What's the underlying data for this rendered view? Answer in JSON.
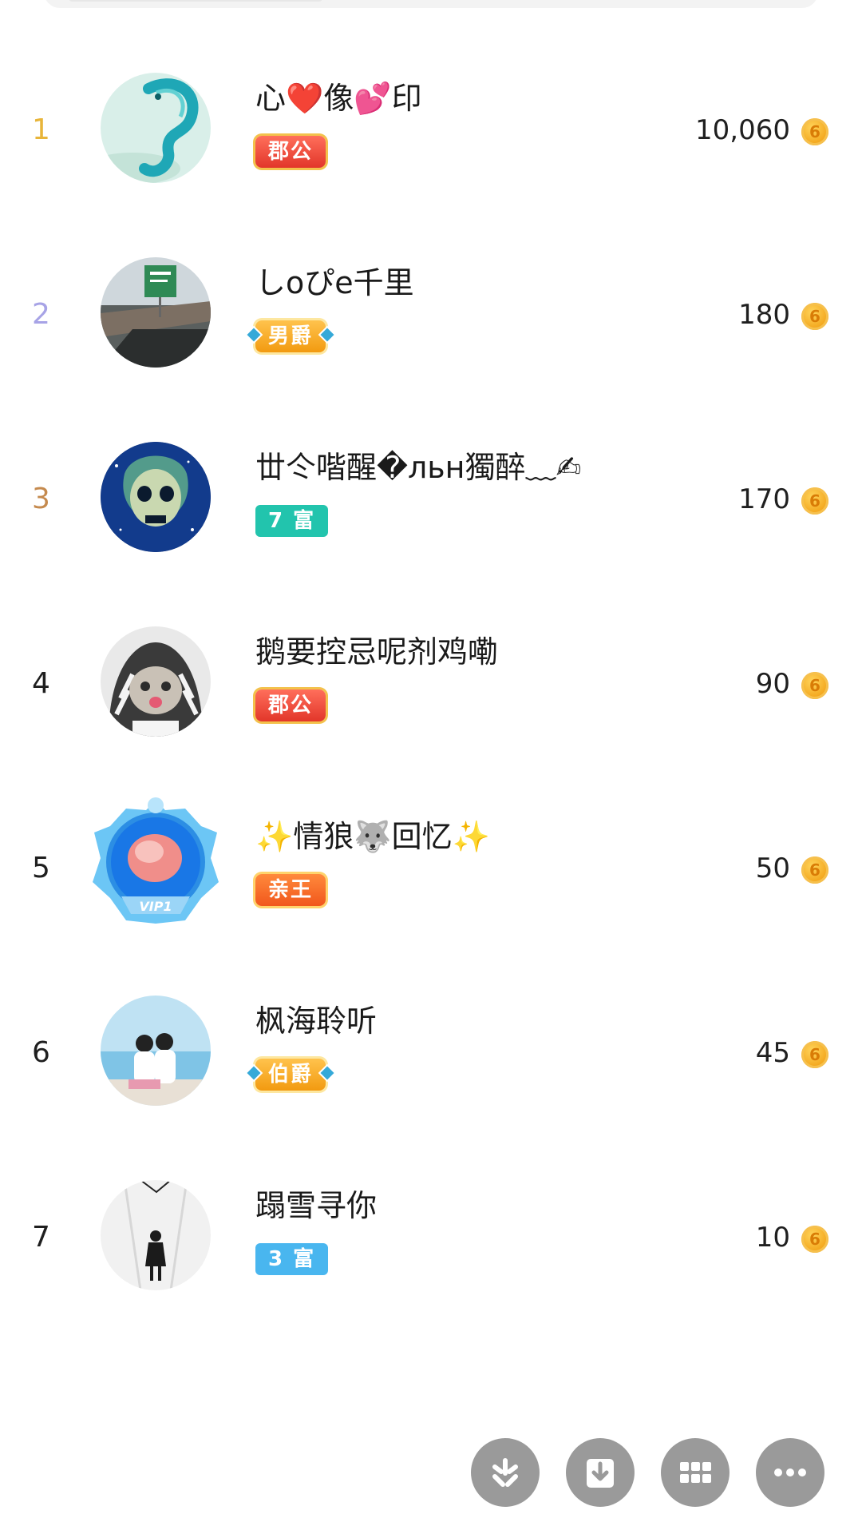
{
  "leaderboard": {
    "entries": [
      {
        "rank": "1",
        "name": "心❤️像💕印",
        "badge": "郡公",
        "score": "10,060",
        "rank_color": "#e8b53a"
      },
      {
        "rank": "2",
        "name": "しoぴe千里",
        "badge": "男爵",
        "score": "180",
        "rank_color": "#a7a3e6"
      },
      {
        "rank": "3",
        "name": "丗仒喈醒�льн獨醉﹏✍",
        "badge": "7 富",
        "score": "170",
        "rank_color": "#c58a4e"
      },
      {
        "rank": "4",
        "name": "鹅要控忌呢剂鸡嘞",
        "badge": "郡公",
        "score": "90",
        "rank_color": "#1f1f1f"
      },
      {
        "rank": "5",
        "name": "✨情狼🐺回忆✨",
        "badge": "亲王",
        "score": "50",
        "rank_color": "#1f1f1f"
      },
      {
        "rank": "6",
        "name": "枫海聆听",
        "badge": "伯爵",
        "score": "45",
        "rank_color": "#1f1f1f"
      },
      {
        "rank": "7",
        "name": "蹋雪寻你",
        "badge": "3 富",
        "score": "10",
        "rank_color": "#1f1f1f"
      }
    ]
  },
  "coin_glyph": "6",
  "action_bar": {
    "buttons": [
      "moments-icon",
      "download-icon",
      "grid-icon",
      "more-icon"
    ]
  }
}
